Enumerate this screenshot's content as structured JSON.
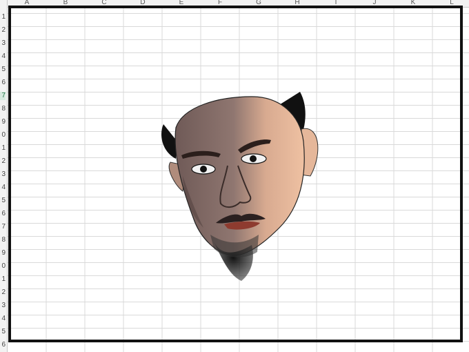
{
  "spreadsheet": {
    "columns": [
      "A",
      "B",
      "C",
      "D",
      "E",
      "F",
      "G",
      "H",
      "I",
      "J",
      "K",
      "L"
    ],
    "rows": [
      "1",
      "2",
      "3",
      "4",
      "5",
      "6",
      "7",
      "8",
      "9",
      "0",
      "1",
      "2",
      "3",
      "4",
      "5",
      "6",
      "7",
      "8",
      "9",
      "0",
      "1",
      "2",
      "3",
      "4",
      "5",
      "6"
    ],
    "selected_row_index": 6
  },
  "drawing": {
    "subject": "illustrated-portrait-face",
    "frame_color": "#111111"
  }
}
